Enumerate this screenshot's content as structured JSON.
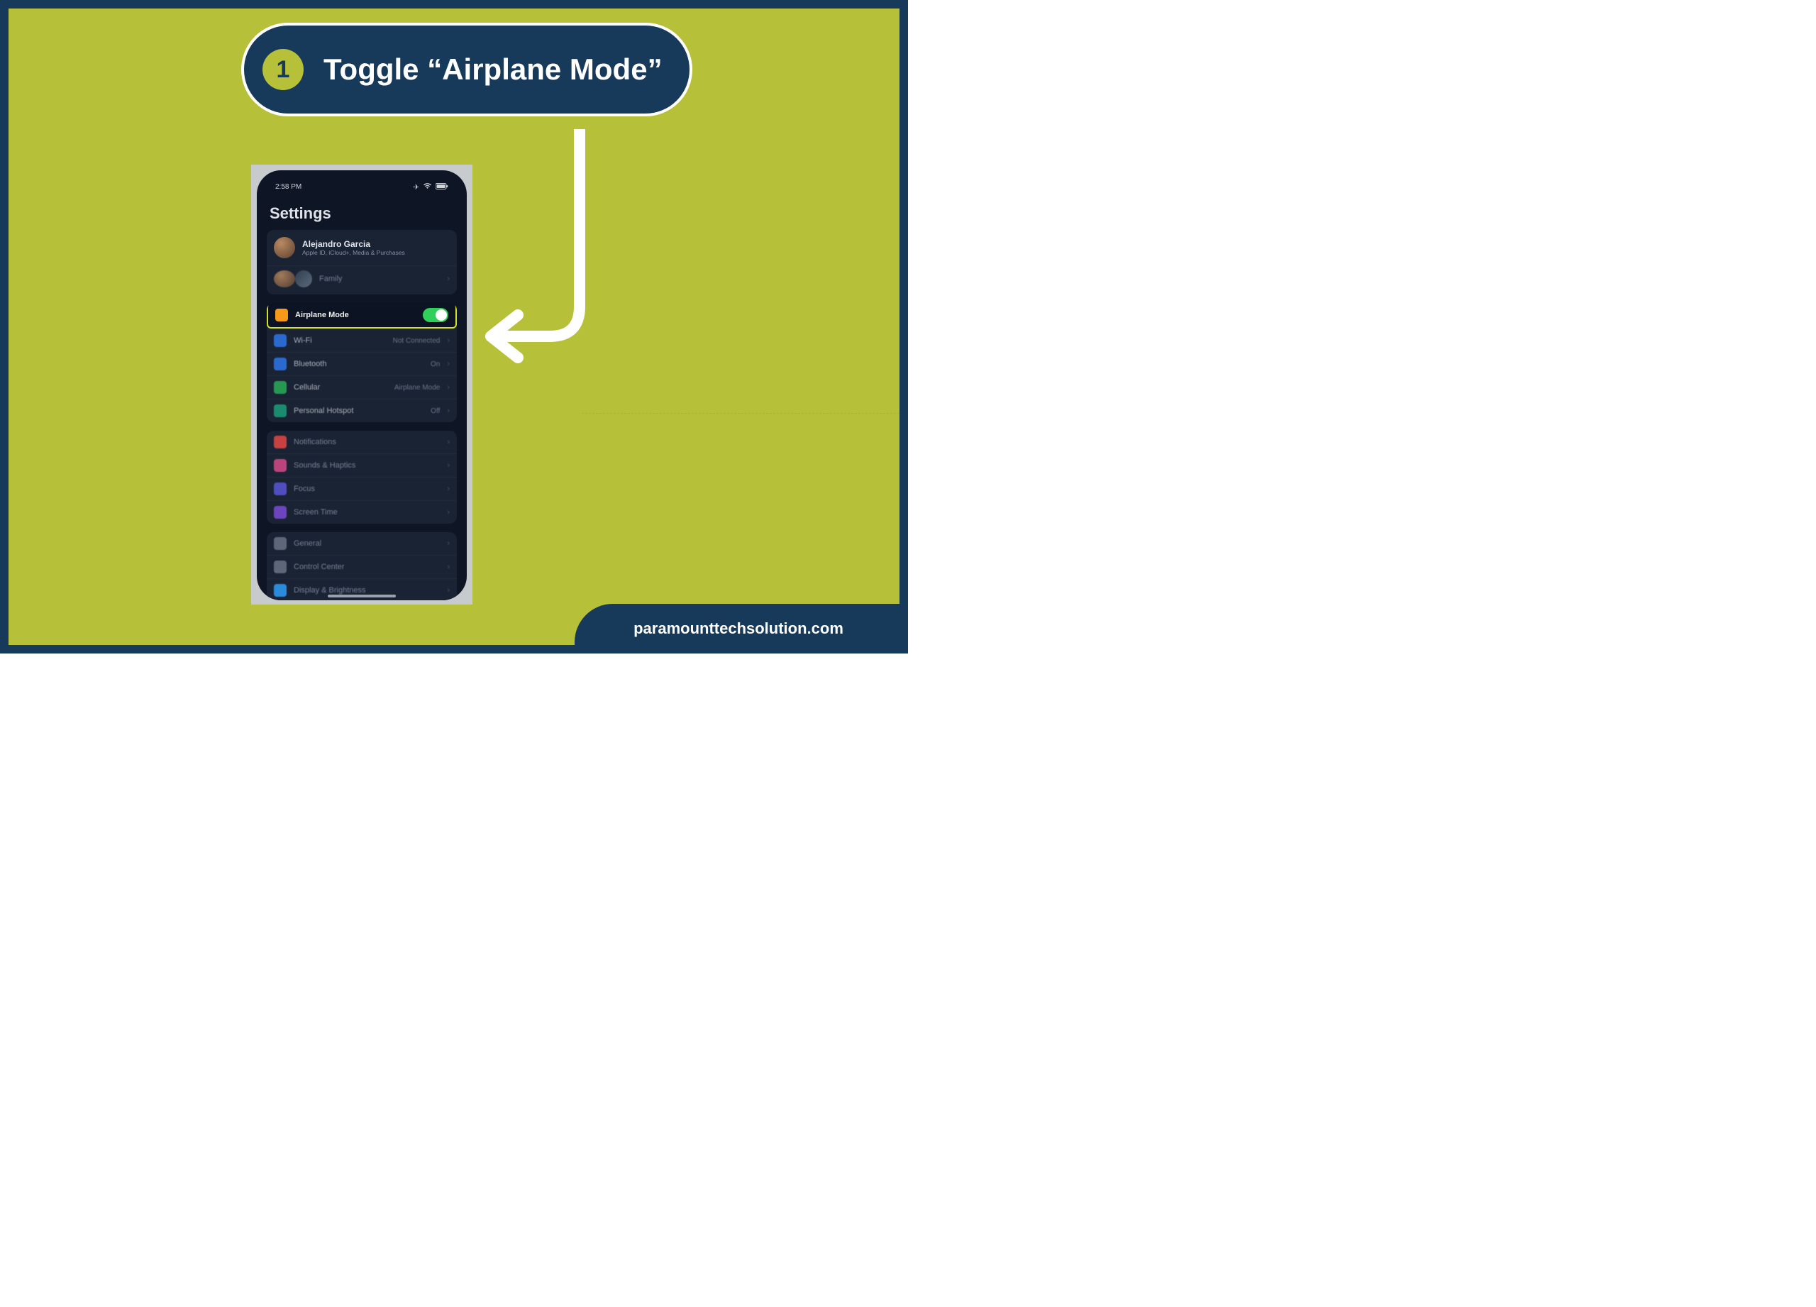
{
  "step": {
    "number": "1",
    "title": "Toggle “Airplane Mode”"
  },
  "footer": {
    "site": "paramounttechsolution.com"
  },
  "phone": {
    "time": "2:58 PM",
    "heading": "Settings",
    "profile": {
      "name": "Alejandro Garcia",
      "sub": "Apple ID, iCloud+, Media & Purchases"
    },
    "family_label": "Family",
    "group1": [
      {
        "label": "Airplane Mode",
        "icon": "ic-orange",
        "toggle": true,
        "highlight": true
      },
      {
        "label": "Wi-Fi",
        "value": "Not Connected",
        "icon": "ic-blue"
      },
      {
        "label": "Bluetooth",
        "value": "On",
        "icon": "ic-blue2"
      },
      {
        "label": "Cellular",
        "value": "Airplane Mode",
        "icon": "ic-green"
      },
      {
        "label": "Personal Hotspot",
        "value": "Off",
        "icon": "ic-teal"
      }
    ],
    "group2": [
      {
        "label": "Notifications",
        "icon": "ic-red"
      },
      {
        "label": "Sounds & Haptics",
        "icon": "ic-pink"
      },
      {
        "label": "Focus",
        "icon": "ic-indigo"
      },
      {
        "label": "Screen Time",
        "icon": "ic-purple"
      }
    ],
    "group3": [
      {
        "label": "General",
        "icon": "ic-gray"
      },
      {
        "label": "Control Center",
        "icon": "ic-gray"
      },
      {
        "label": "Display & Brightness",
        "icon": "ic-sky"
      }
    ]
  }
}
